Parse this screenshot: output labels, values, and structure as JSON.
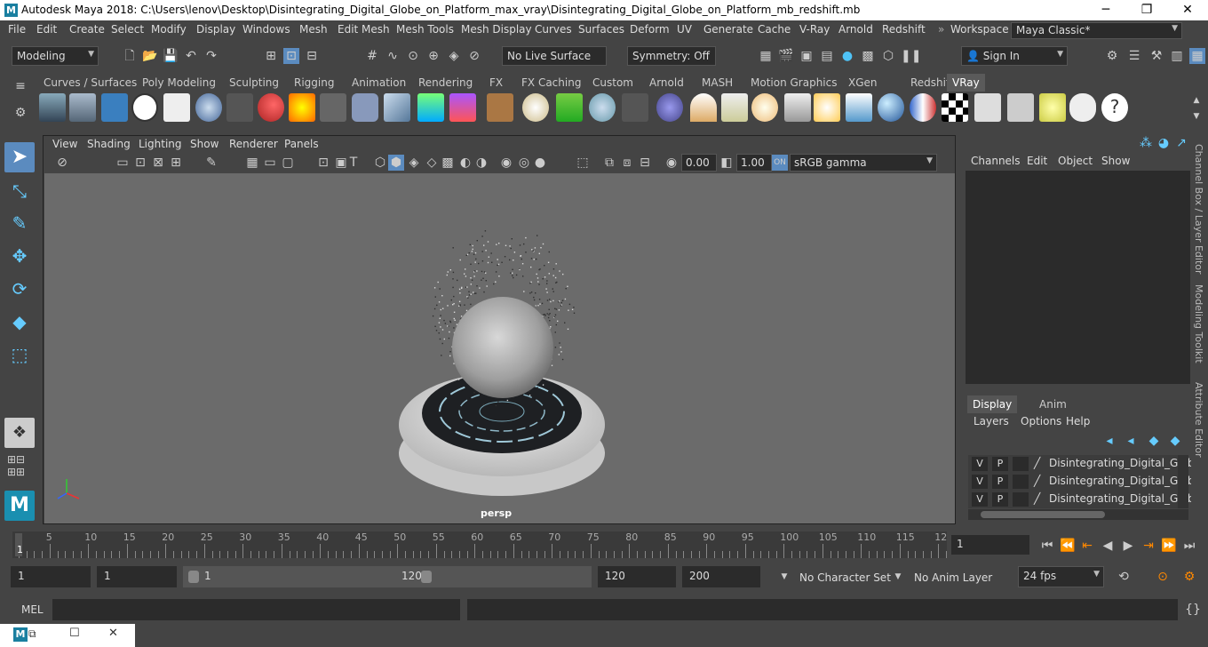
{
  "window": {
    "title": "Autodesk Maya 2018: C:\\Users\\lenov\\Desktop\\Disintegrating_Digital_Globe_on_Platform_max_vray\\Disintegrating_Digital_Globe_on_Platform_mb_redshift.mb",
    "minimize": "─",
    "maximize": "❐",
    "close": "✕"
  },
  "menubar": {
    "items": [
      "File",
      "Edit",
      "Create",
      "Select",
      "Modify",
      "Display",
      "Windows",
      "Mesh",
      "Edit Mesh",
      "Mesh Tools",
      "Mesh Display",
      "Curves",
      "Surfaces",
      "Deform",
      "UV",
      "Generate",
      "Cache",
      "V-Ray",
      "Arnold",
      "Redshift"
    ],
    "workspace_label": "Workspace :",
    "workspace_value": "Maya Classic*"
  },
  "statusline": {
    "mode": "Modeling",
    "live_surface": "No Live Surface",
    "symmetry": "Symmetry: Off",
    "sign_in": "Sign In"
  },
  "shelf": {
    "tabs": [
      "Curves / Surfaces",
      "Poly Modeling",
      "Sculpting",
      "Rigging",
      "Animation",
      "Rendering",
      "FX",
      "FX Caching",
      "Custom",
      "Arnold",
      "MASH",
      "Motion Graphics",
      "XGen",
      "Redshift",
      "VRay"
    ],
    "active_tab": "VRay"
  },
  "viewport": {
    "menus": [
      "View",
      "Shading",
      "Lighting",
      "Show",
      "Renderer",
      "Panels"
    ],
    "exposure": "0.00",
    "gamma": "1.00",
    "color_space": "sRGB gamma",
    "camera_label": "persp"
  },
  "channelbox": {
    "menus": [
      "Channels",
      "Edit",
      "Object",
      "Show"
    ]
  },
  "layers": {
    "tabs": [
      "Display",
      "Anim"
    ],
    "menus": [
      "Layers",
      "Options",
      "Help"
    ],
    "rows": [
      {
        "v": "V",
        "p": "P",
        "name": "Disintegrating_Digital_Glob"
      },
      {
        "v": "V",
        "p": "P",
        "name": "Disintegrating_Digital_Glob"
      },
      {
        "v": "V",
        "p": "P",
        "name": "Disintegrating_Digital_Glob"
      }
    ]
  },
  "side_tabs": [
    "Channel Box / Layer Editor",
    "Modeling Toolkit",
    "Attribute Editor"
  ],
  "timeline": {
    "ticks": [
      "5",
      "10",
      "15",
      "20",
      "25",
      "30",
      "35",
      "40",
      "45",
      "50",
      "55",
      "60",
      "65",
      "70",
      "75",
      "80",
      "85",
      "90",
      "95",
      "100",
      "105",
      "110",
      "115",
      "12"
    ],
    "start_marker": "1",
    "current_frame": "1"
  },
  "range": {
    "start": "1",
    "playback_start": "1",
    "slider_start": "1",
    "slider_end": "120",
    "playback_end": "120",
    "end": "200",
    "character_set": "No Character Set",
    "anim_layer": "No Anim Layer",
    "fps": "24 fps"
  },
  "cmdline": {
    "label": "MEL"
  }
}
